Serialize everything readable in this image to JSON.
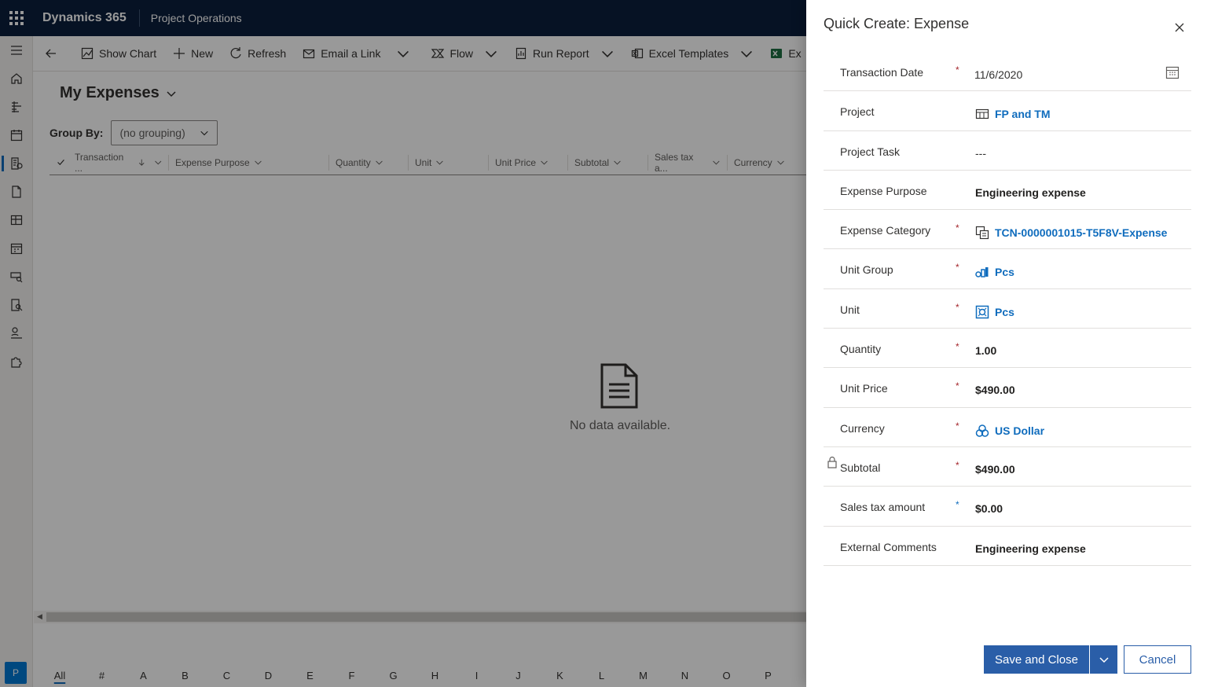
{
  "topbar": {
    "app_name": "Dynamics 365",
    "area_name": "Project Operations"
  },
  "commands": {
    "show_chart": "Show Chart",
    "new": "New",
    "refresh": "Refresh",
    "email_link": "Email a Link",
    "flow": "Flow",
    "run_report": "Run Report",
    "excel_templates": "Excel Templates",
    "export_truncated": "Ex"
  },
  "view": {
    "title": "My Expenses",
    "group_by_label": "Group By:",
    "group_by_value": "(no grouping)",
    "columns": [
      "Transaction ...",
      "Expense Purpose",
      "Quantity",
      "Unit",
      "Unit Price",
      "Subtotal",
      "Sales tax a...",
      "Currency"
    ],
    "empty_text": "No data available.",
    "jump_letters": [
      "All",
      "#",
      "A",
      "B",
      "C",
      "D",
      "E",
      "F",
      "G",
      "H",
      "I",
      "J",
      "K",
      "L",
      "M",
      "N",
      "O",
      "P"
    ]
  },
  "user": {
    "avatar_initial": "P"
  },
  "quick_create": {
    "title": "Quick Create: Expense",
    "fields": {
      "transaction_date": {
        "label": "Transaction Date",
        "value": "11/6/2020",
        "req": "*"
      },
      "project": {
        "label": "Project",
        "value": "FP and TM"
      },
      "project_task": {
        "label": "Project Task",
        "value": "---"
      },
      "expense_purpose": {
        "label": "Expense Purpose",
        "value": "Engineering expense"
      },
      "expense_category": {
        "label": "Expense Category",
        "value": "TCN-0000001015-T5F8V-Expense",
        "req": "*"
      },
      "unit_group": {
        "label": "Unit Group",
        "value": "Pcs",
        "req": "*"
      },
      "unit": {
        "label": "Unit",
        "value": "Pcs",
        "req": "*"
      },
      "quantity": {
        "label": "Quantity",
        "value": "1.00",
        "req": "*"
      },
      "unit_price": {
        "label": "Unit Price",
        "value": "$490.00",
        "req": "*"
      },
      "currency": {
        "label": "Currency",
        "value": "US Dollar",
        "req": "*"
      },
      "subtotal": {
        "label": "Subtotal",
        "value": "$490.00",
        "req": "*"
      },
      "sales_tax": {
        "label": "Sales tax amount",
        "value": "$0.00",
        "req": "*"
      },
      "external_comments": {
        "label": "External Comments",
        "value": "Engineering expense"
      }
    },
    "save_label": "Save and Close",
    "cancel_label": "Cancel"
  },
  "colors": {
    "topbar_bg": "#0b1e3d",
    "primary": "#2a5ea8",
    "link": "#0f6cbd",
    "required": "#a4262c"
  }
}
